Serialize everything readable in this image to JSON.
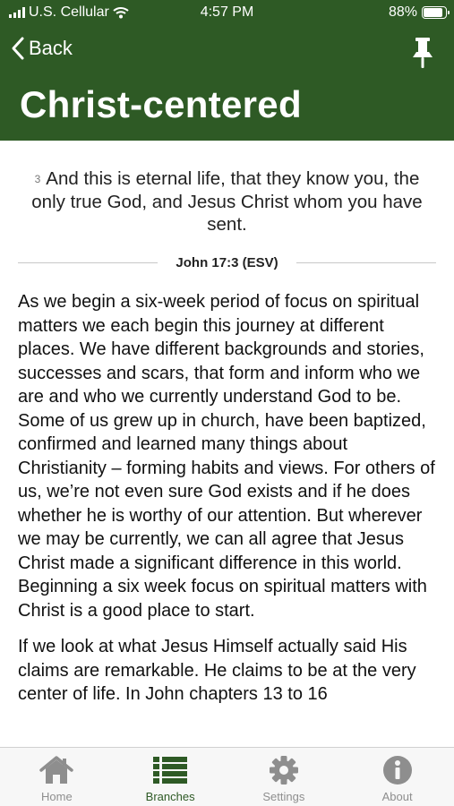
{
  "status_bar": {
    "carrier": "U.S. Cellular",
    "time": "4:57 PM",
    "battery": "88%",
    "battery_level": 0.88
  },
  "nav": {
    "back_label": "Back",
    "pin_icon": "pin-icon"
  },
  "page": {
    "title": "Christ-centered"
  },
  "verse": {
    "number": "3",
    "text": "And this is eternal life, that they know you, the only true God, and Jesus Christ whom you have sent.",
    "reference": "John 17:3 (ESV)"
  },
  "body": {
    "paragraphs": [
      "As we begin a six-week period of focus on spiritual matters we each begin this journey at different places. We have different backgrounds and stories, successes and scars, that form and inform who we are and who we currently understand God to be. Some of us grew up in church, have been baptized, confirmed and learned many things about Christianity – forming habits and views. For others of us, we’re not even sure God exists and if he does whether he is worthy of our attention. But wherever we may be currently, we can all agree that Jesus Christ made a significant difference in this world. Beginning a six week focus on spiritual matters with Christ is a good place to start.",
      "If we look at what Jesus Himself actually said His claims are remarkable. He claims to be at the very center of life. In John chapters 13 to 16"
    ]
  },
  "tabs": [
    {
      "label": "Home",
      "icon": "home-icon"
    },
    {
      "label": "Branches",
      "icon": "list-icon",
      "active": true
    },
    {
      "label": "Settings",
      "icon": "gear-icon"
    },
    {
      "label": "About",
      "icon": "info-icon"
    }
  ],
  "colors": {
    "header": "#2e5a25",
    "tab_active": "#2e5a25",
    "tab_inactive": "#8e8e8e"
  }
}
